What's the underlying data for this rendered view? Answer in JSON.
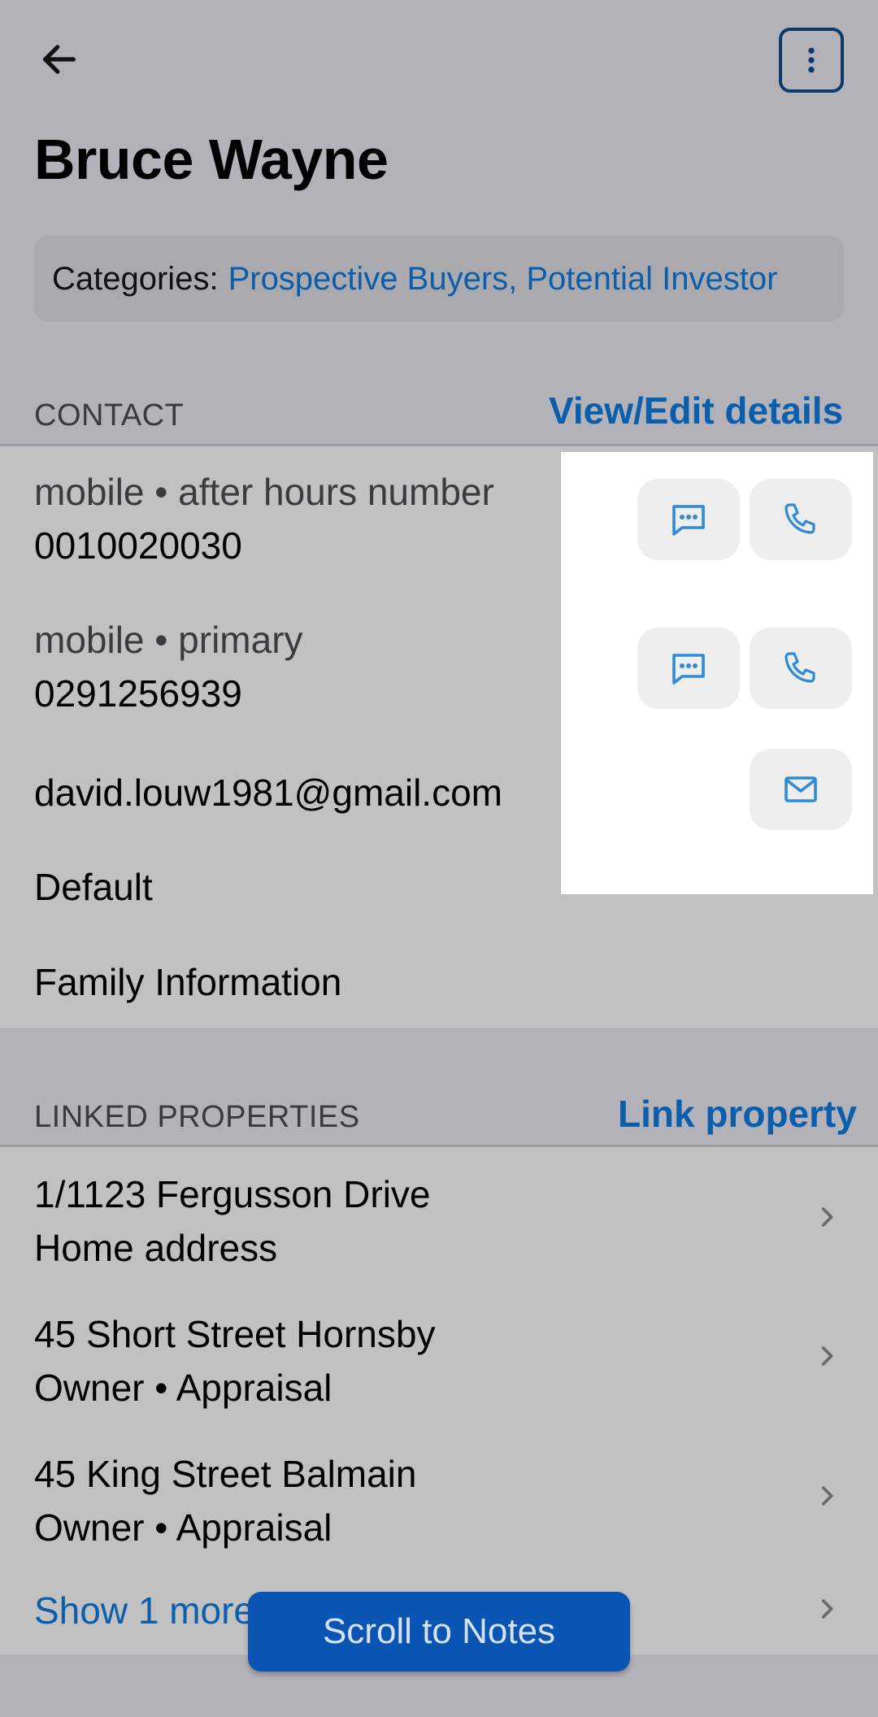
{
  "header": {
    "title": "Bruce Wayne"
  },
  "categories": {
    "label": "Categories:",
    "values": "Prospective Buyers, Potential Investor"
  },
  "contact": {
    "heading": "CONTACT",
    "link": "View/Edit details",
    "rows": [
      {
        "sub": "mobile • after hours number",
        "main": "0010020030"
      },
      {
        "sub": "mobile • primary",
        "main": "0291256939"
      },
      {
        "main": "david.louw1981@gmail.com"
      },
      {
        "main": "Default"
      },
      {
        "main": "Family Information"
      }
    ]
  },
  "linked_properties": {
    "heading": "LINKED PROPERTIES",
    "link": "Link property",
    "items": [
      {
        "line1": "1/1123 Fergusson Drive",
        "line2": "Home address"
      },
      {
        "line1": "45 Short Street Hornsby",
        "line2": "Owner • Appraisal"
      },
      {
        "line1": "45 King Street Balmain",
        "line2": "Owner • Appraisal"
      }
    ],
    "show_more": "Show 1 more"
  },
  "floating": {
    "scroll_label": "Scroll to Notes"
  },
  "icons": {
    "back": "arrow-left-icon",
    "more": "more-vertical-icon",
    "sms": "message-icon",
    "call": "phone-icon",
    "email": "mail-icon",
    "chevron": "chevron-right-icon"
  },
  "colors": {
    "accent": "#0b5eab",
    "button": "#0a55b3",
    "icon_blue": "#2f8ad8"
  }
}
